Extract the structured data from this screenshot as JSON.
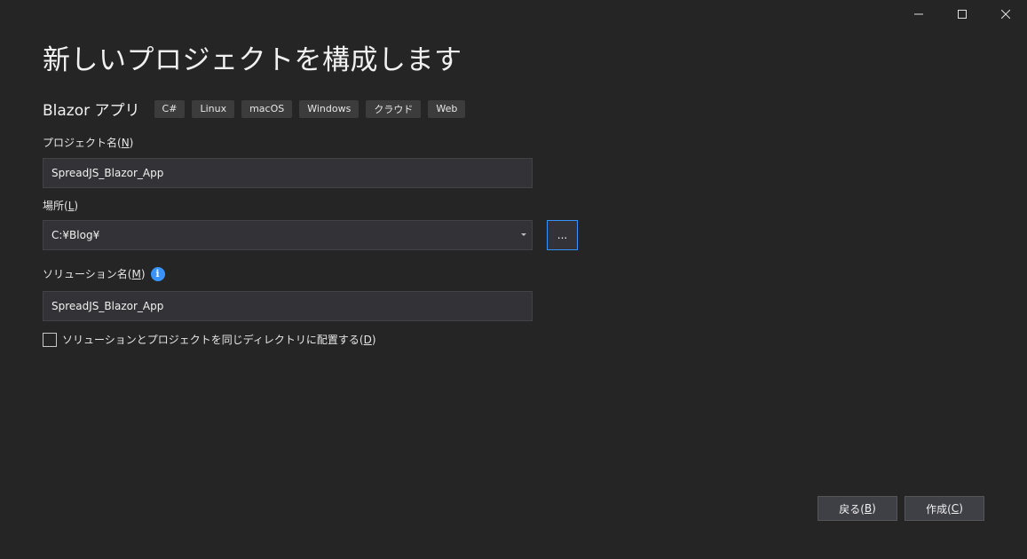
{
  "window_controls": {
    "minimize_icon": "minimize-icon",
    "maximize_icon": "maximize-icon",
    "close_icon": "close-icon"
  },
  "page": {
    "title": "新しいプロジェクトを構成します"
  },
  "template": {
    "name": "Blazor アプリ",
    "tags": [
      "C#",
      "Linux",
      "macOS",
      "Windows",
      "クラウド",
      "Web"
    ]
  },
  "project_name": {
    "label_prefix": "プロジェクト名(",
    "label_key": "N",
    "label_suffix": ")",
    "value": "SpreadJS_Blazor_App"
  },
  "location": {
    "label_prefix": "場所(",
    "label_key": "L",
    "label_suffix": ")",
    "value": "C:¥Blog¥",
    "browse_label": "..."
  },
  "solution_name": {
    "label_prefix": "ソリューション名(",
    "label_key": "M",
    "label_suffix": ")",
    "info_glyph": "i",
    "value": "SpreadJS_Blazor_App"
  },
  "same_directory": {
    "label_prefix": "ソリューションとプロジェクトを同じディレクトリに配置する(",
    "label_key": "D",
    "label_suffix": ")",
    "checked": false
  },
  "footer": {
    "back_prefix": "戻る(",
    "back_key": "B",
    "back_suffix": ")",
    "create_prefix": "作成(",
    "create_key": "C",
    "create_suffix": ")"
  },
  "colors": {
    "background": "#252526",
    "field_bg": "#333337",
    "accent": "#3794ff"
  }
}
